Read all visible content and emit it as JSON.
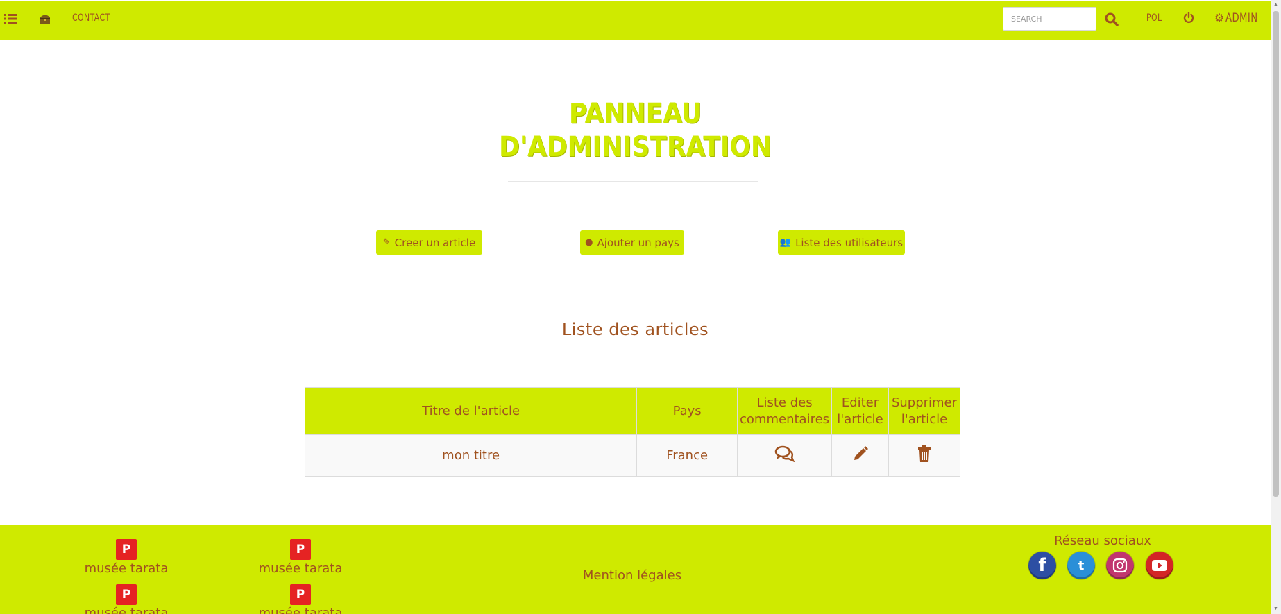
{
  "colors": {
    "accent": "#cfea00",
    "text": "#a0521f",
    "pinterest": "#e52323"
  },
  "nav": {
    "menu_icon": "list-icon",
    "home_icon": "treasure-chest-icon",
    "contact": "CONTACT",
    "search_placeholder": "SEARCH",
    "search_icon": "search-icon",
    "lang": "POL",
    "power_icon": "power-icon",
    "admin": "ADMIN",
    "admin_icon": "gears-icon"
  },
  "admin": {
    "title_line1": "PANNEAU",
    "title_line2": "D'ADMINISTRATION"
  },
  "actions": {
    "create_article": "Creer un article",
    "add_country": "Ajouter un pays",
    "users_list": "Liste des utilisateurs"
  },
  "articles": {
    "title": "Liste des articles",
    "headers": [
      "Titre de l'article",
      "Pays",
      "Liste des commentaires",
      "Editer l'article",
      "Supprimer l'article"
    ],
    "rows": [
      {
        "title": "mon titre",
        "country": "France",
        "comments_icon": "comments-icon",
        "edit_icon": "pencil-icon",
        "delete_icon": "trash-icon"
      }
    ]
  },
  "footer": {
    "pinterest_links": [
      "musée tarata",
      "musée tarata",
      "musée tarata",
      "musée tarata"
    ],
    "legal": "Mention légales",
    "social_title": "Réseau sociaux",
    "social_icons": [
      "facebook-icon",
      "twitter-icon",
      "instagram-icon",
      "youtube-icon"
    ]
  }
}
